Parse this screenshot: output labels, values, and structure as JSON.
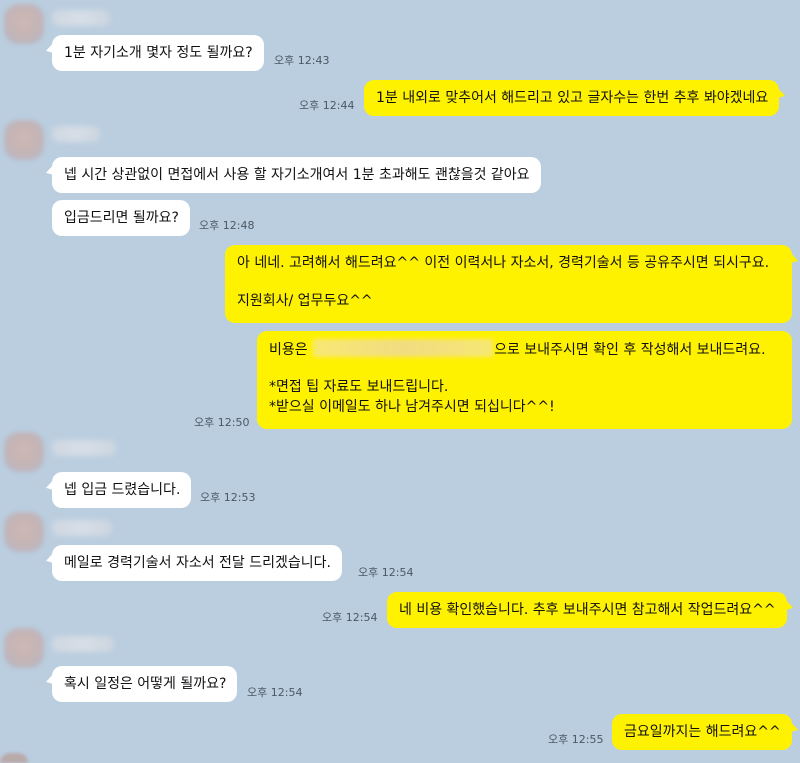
{
  "messages": [
    {
      "dir": "in",
      "text": "1분 자기소개 몇자 정도 될까요?",
      "time": "오후 12:43"
    },
    {
      "dir": "out",
      "text": "1분 내외로 맞추어서 해드리고 있고 글자수는 한번 추후 봐야겠네요",
      "time": "오후 12:44"
    },
    {
      "dir": "in",
      "text": "넵 시간 상관없이 면접에서 사용 할 자기소개여서 1분 초과해도 괜찮을것 같아요"
    },
    {
      "dir": "in",
      "text": "입금드리면 될까요?",
      "time": "오후 12:48"
    },
    {
      "dir": "out",
      "lines": [
        "아 네네. 고려해서 해드려요^^ 이전 이력서나 자소서, 경력기술서 등 공유주시면 되시구요.",
        "지원회사/ 업무두요^^"
      ]
    },
    {
      "dir": "out",
      "line1_before": "비용은",
      "line1_after": "으로 보내주시면 확인 후 작성해서 보내드려요.",
      "lines_rest": [
        "*면접 팁 자료도 보내드립니다.",
        "*받으실 이메일도 하나 남겨주시면 되십니다^^!"
      ],
      "time": "오후 12:50"
    },
    {
      "dir": "in",
      "text": "넵 입금 드렸습니다.",
      "time": "오후 12:53"
    },
    {
      "dir": "in",
      "text": "메일로 경력기술서 자소서 전달 드리겠습니다.",
      "time": "오후 12:54"
    },
    {
      "dir": "out",
      "text": "네 비용 확인했습니다. 추후 보내주시면 참고해서 작업드려요^^",
      "time": "오후 12:54"
    },
    {
      "dir": "in",
      "text": "혹시 일정은 어떻게 될까요?",
      "time": "오후 12:54"
    },
    {
      "dir": "out",
      "text": "금요일까지는 해드려요^^",
      "time": "오후 12:55"
    }
  ]
}
